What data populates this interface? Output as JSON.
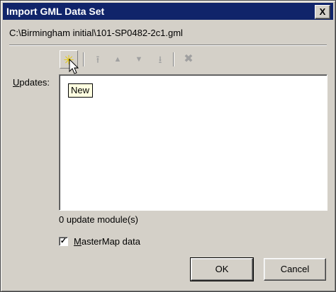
{
  "window": {
    "title": "Import GML Data Set",
    "close_label": "X"
  },
  "file_path": "C:\\Birmingham initial\\101-SP0482-2c1.gml",
  "toolbar": {
    "new_glyph": "✳",
    "move_top_glyph": "⭱",
    "move_up_glyph": "▲",
    "move_down_glyph": "▼",
    "move_bottom_glyph": "⭳",
    "delete_glyph": "✖"
  },
  "updates": {
    "label_accesskey": "U",
    "label_rest": "pdates:"
  },
  "tooltip": "New",
  "status": {
    "module_count": "0 update module(s)"
  },
  "mastermap": {
    "checked_glyph": "✓",
    "label_accesskey": "M",
    "label_rest": "asterMap data",
    "checked": true
  },
  "buttons": {
    "ok": "OK",
    "cancel": "Cancel"
  }
}
